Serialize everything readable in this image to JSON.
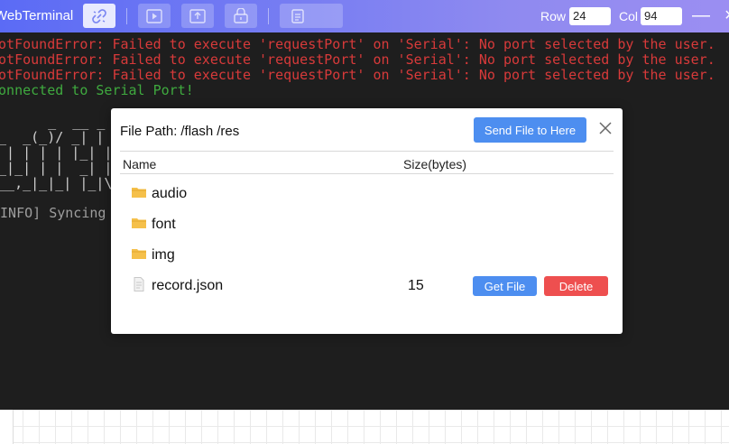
{
  "app": {
    "title": "WebTerminal"
  },
  "toolbar": {
    "row_label": "Row",
    "row_value": "24",
    "col_label": "Col",
    "col_value": "94",
    "icons": [
      "link-icon",
      "run-icon",
      "upload-icon",
      "download-icon",
      "file-icon"
    ]
  },
  "window": {
    "minimize": "—",
    "close": "×"
  },
  "terminal": {
    "lines": [
      "NotFoundError: Failed to execute 'requestPort' on 'Serial': No port selected by the user.",
      "NotFoundError: Failed to execute 'requestPort' on 'Serial': No port selected by the user.",
      "NotFoundError: Failed to execute 'requestPort' on 'Serial': No port selected by the user.",
      "Connected to Serial Port!"
    ],
    "ascii_art": [
      "      _  __ _",
      "__  _(_)/ _| |",
      "  | | | | |_| |/",
      "__|_| | |  _| |",
      "___,_|_|_| |_|\\"
    ],
    "info_line": "[INFO] Syncing r"
  },
  "modal": {
    "title_prefix": "File Path:",
    "path_parts": [
      "/flash",
      "/res"
    ],
    "send_button": "Send File to Here",
    "columns": {
      "name": "Name",
      "size": "Size(bytes)"
    },
    "rows": [
      {
        "name": "audio",
        "type": "folder",
        "size": ""
      },
      {
        "name": "font",
        "type": "folder",
        "size": ""
      },
      {
        "name": "img",
        "type": "folder",
        "size": ""
      },
      {
        "name": "record.json",
        "type": "file",
        "size": "15",
        "get_label": "Get File",
        "delete_label": "Delete"
      }
    ]
  },
  "colors": {
    "accent": "#5b6bf5",
    "error": "#d83a3a",
    "success": "#3faa3f",
    "button_blue": "#4d8ef0",
    "button_red": "#ee4f4f",
    "folder": "#f5c04a"
  }
}
